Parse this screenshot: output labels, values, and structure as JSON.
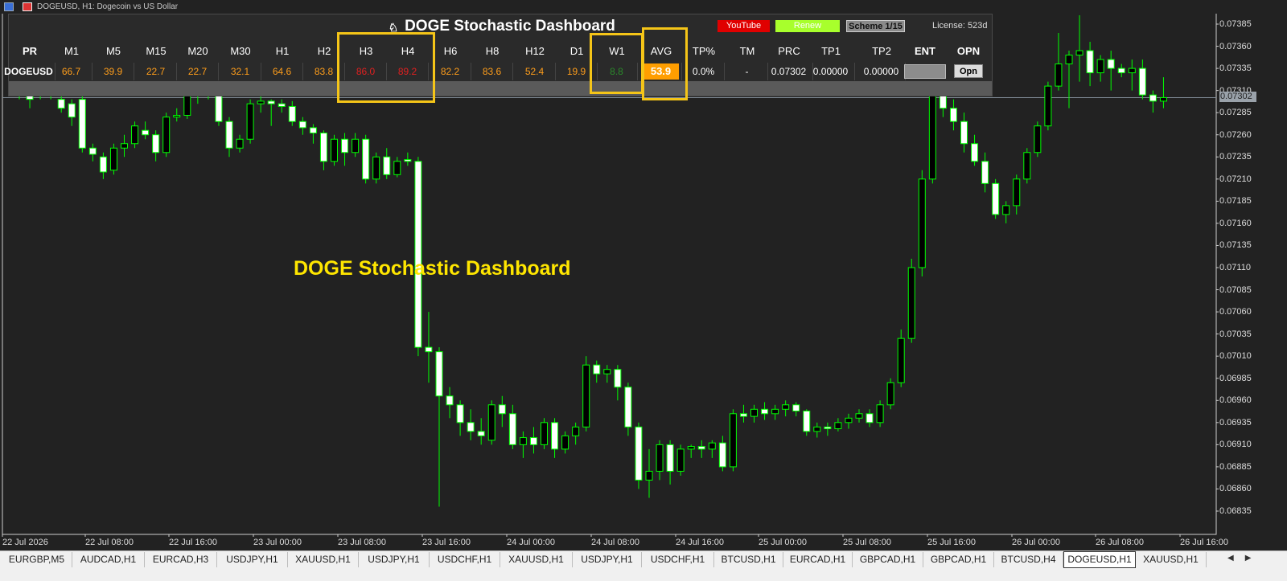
{
  "window": {
    "title": "DOGEUSD, H1:  Dogecoin vs US Dollar"
  },
  "dashboard": {
    "title": "DOGE Stochastic Dashboard",
    "youtube_label": "YouTube",
    "renew_label": "Renew",
    "scheme_label": "Scheme 1/15",
    "license": "License: 523d",
    "headers": [
      "PR",
      "M1",
      "M5",
      "M15",
      "M20",
      "M30",
      "H1",
      "H2",
      "H3",
      "H4",
      "H6",
      "H8",
      "H12",
      "D1",
      "W1",
      "AVG",
      "TP%",
      "TM",
      "PRC",
      "TP1",
      "TP2",
      "ENT",
      "OPN"
    ],
    "row": {
      "symbol": "DOGEUSD",
      "values": [
        "66.7",
        "39.9",
        "22.7",
        "22.7",
        "32.1",
        "64.6",
        "83.8",
        "86.0",
        "89.2",
        "82.2",
        "83.6",
        "52.4",
        "19.9",
        "8.8",
        "53.9"
      ],
      "tp_pct": "0.0%",
      "tm": "-",
      "prc": "0.07302",
      "tp1": "0.00000",
      "tp2": "0.00000",
      "opn_label": "Opn"
    }
  },
  "overlay_title": "DOGE Stochastic Dashboard",
  "price_axis": {
    "ticks": [
      "0.07385",
      "0.07360",
      "0.07335",
      "0.07310",
      "0.07285",
      "0.07260",
      "0.07235",
      "0.07210",
      "0.07185",
      "0.07160",
      "0.07135",
      "0.07110",
      "0.07085",
      "0.07060",
      "0.07035",
      "0.07010",
      "0.06985",
      "0.06960",
      "0.06935",
      "0.06910",
      "0.06885",
      "0.06860",
      "0.06835"
    ],
    "current": "0.07302"
  },
  "time_axis": {
    "ticks": [
      "22 Jul 2026",
      "22 Jul 08:00",
      "22 Jul 16:00",
      "23 Jul 00:00",
      "23 Jul 08:00",
      "23 Jul 16:00",
      "24 Jul 00:00",
      "24 Jul 08:00",
      "24 Jul 16:00",
      "25 Jul 00:00",
      "25 Jul 08:00",
      "25 Jul 16:00",
      "26 Jul 00:00",
      "26 Jul 08:00",
      "26 Jul 16:00"
    ]
  },
  "tabs": [
    "EURGBP,M5",
    "AUDCAD,H1",
    "EURCAD,H3",
    "USDJPY,H1",
    "XAUUSD,H1",
    "USDJPY,H1",
    "USDCHF,H1",
    "XAUUSD,H1",
    "USDJPY,H1",
    "USDCHF,H1",
    "BTCUSD,H1",
    "EURCAD,H1",
    "GBPCAD,H1",
    "GBPCAD,H1",
    "BTCUSD,H4",
    "DOGEUSD,H1",
    "XAUUSD,H1"
  ],
  "active_tab": "DOGEUSD,H1",
  "colors": {
    "background": "#222222",
    "bull_candle": "#000000",
    "bear_candle": "#ffffff",
    "wick": "#00ff00",
    "youtube": "#e00000",
    "renew": "#a8ff2c",
    "avg_badge": "#ff9e00",
    "highlight": "#f5c518",
    "overlay_text": "#ffe600"
  },
  "chart_data": {
    "type": "candlestick",
    "symbol": "DOGEUSD",
    "timeframe": "H1",
    "ylim": [
      0.0682,
      0.074
    ],
    "candles": [
      [
        0.07322,
        0.0733,
        0.073,
        0.07305
      ],
      [
        0.07305,
        0.0731,
        0.0729,
        0.073
      ],
      [
        0.0731,
        0.0732,
        0.073,
        0.07308
      ],
      [
        0.07312,
        0.0732,
        0.073,
        0.07305
      ],
      [
        0.073,
        0.0731,
        0.07285,
        0.0729
      ],
      [
        0.07295,
        0.073,
        0.0727,
        0.0728
      ],
      [
        0.073,
        0.07305,
        0.0724,
        0.07245
      ],
      [
        0.07245,
        0.0725,
        0.0723,
        0.07238
      ],
      [
        0.07235,
        0.0724,
        0.0721,
        0.07218
      ],
      [
        0.0722,
        0.0725,
        0.07215,
        0.07245
      ],
      [
        0.07245,
        0.0726,
        0.07235,
        0.0725
      ],
      [
        0.0725,
        0.07275,
        0.07245,
        0.0727
      ],
      [
        0.07265,
        0.07275,
        0.07255,
        0.0726
      ],
      [
        0.0726,
        0.07265,
        0.0723,
        0.0724
      ],
      [
        0.0724,
        0.07285,
        0.07235,
        0.0728
      ],
      [
        0.0728,
        0.0729,
        0.07275,
        0.07282
      ],
      [
        0.07282,
        0.07315,
        0.07278,
        0.07305
      ],
      [
        0.07305,
        0.0732,
        0.07295,
        0.07308
      ],
      [
        0.07308,
        0.07318,
        0.073,
        0.0731
      ],
      [
        0.0731,
        0.07312,
        0.0727,
        0.07275
      ],
      [
        0.07275,
        0.0728,
        0.07235,
        0.07245
      ],
      [
        0.07245,
        0.0726,
        0.0724,
        0.07255
      ],
      [
        0.07255,
        0.073,
        0.0725,
        0.07295
      ],
      [
        0.07295,
        0.07305,
        0.07285,
        0.07298
      ],
      [
        0.07298,
        0.073,
        0.0727,
        0.07295
      ],
      [
        0.07295,
        0.073,
        0.07285,
        0.07292
      ],
      [
        0.07292,
        0.07298,
        0.0727,
        0.07275
      ],
      [
        0.07275,
        0.0728,
        0.0726,
        0.07268
      ],
      [
        0.07268,
        0.07272,
        0.0725,
        0.07262
      ],
      [
        0.07262,
        0.07265,
        0.0722,
        0.0723
      ],
      [
        0.0723,
        0.0726,
        0.07225,
        0.07255
      ],
      [
        0.07255,
        0.07262,
        0.07225,
        0.0724
      ],
      [
        0.0724,
        0.07262,
        0.07235,
        0.07255
      ],
      [
        0.07255,
        0.0726,
        0.07205,
        0.0721
      ],
      [
        0.0721,
        0.0724,
        0.07205,
        0.07235
      ],
      [
        0.07235,
        0.07245,
        0.0721,
        0.07215
      ],
      [
        0.07215,
        0.07235,
        0.07212,
        0.0723
      ],
      [
        0.07232,
        0.0724,
        0.07225,
        0.0723
      ],
      [
        0.0723,
        0.07235,
        0.0701,
        0.0702
      ],
      [
        0.0702,
        0.0706,
        0.0698,
        0.07015
      ],
      [
        0.07015,
        0.0702,
        0.0684,
        0.06965
      ],
      [
        0.06965,
        0.06975,
        0.0694,
        0.06955
      ],
      [
        0.06955,
        0.0696,
        0.0692,
        0.06935
      ],
      [
        0.06935,
        0.0695,
        0.06915,
        0.06925
      ],
      [
        0.06925,
        0.0694,
        0.0691,
        0.0692
      ],
      [
        0.06915,
        0.0696,
        0.0691,
        0.06955
      ],
      [
        0.06955,
        0.06965,
        0.0693,
        0.06945
      ],
      [
        0.06945,
        0.06955,
        0.06905,
        0.0691
      ],
      [
        0.0691,
        0.06925,
        0.06895,
        0.06918
      ],
      [
        0.06918,
        0.0693,
        0.069,
        0.0691
      ],
      [
        0.0691,
        0.0694,
        0.06905,
        0.06935
      ],
      [
        0.06935,
        0.0694,
        0.06895,
        0.06905
      ],
      [
        0.06905,
        0.06925,
        0.069,
        0.0692
      ],
      [
        0.0692,
        0.06935,
        0.0691,
        0.0693
      ],
      [
        0.0693,
        0.0701,
        0.06925,
        0.07
      ],
      [
        0.07,
        0.07005,
        0.0698,
        0.0699
      ],
      [
        0.0699,
        0.07,
        0.0698,
        0.06995
      ],
      [
        0.06995,
        0.07,
        0.0696,
        0.06975
      ],
      [
        0.06975,
        0.0698,
        0.0692,
        0.0693
      ],
      [
        0.0693,
        0.06935,
        0.0686,
        0.0687
      ],
      [
        0.0687,
        0.06905,
        0.0685,
        0.0688
      ],
      [
        0.0688,
        0.06915,
        0.0687,
        0.0691
      ],
      [
        0.0691,
        0.06915,
        0.06865,
        0.0688
      ],
      [
        0.0688,
        0.0691,
        0.06875,
        0.06905
      ],
      [
        0.06905,
        0.0691,
        0.06895,
        0.06908
      ],
      [
        0.06908,
        0.06915,
        0.06895,
        0.06905
      ],
      [
        0.06905,
        0.06915,
        0.06895,
        0.06912
      ],
      [
        0.06912,
        0.0692,
        0.0688,
        0.06885
      ],
      [
        0.06885,
        0.0695,
        0.0688,
        0.06945
      ],
      [
        0.06945,
        0.06955,
        0.06935,
        0.06942
      ],
      [
        0.06942,
        0.06955,
        0.06935,
        0.0695
      ],
      [
        0.0695,
        0.06958,
        0.06938,
        0.06945
      ],
      [
        0.06945,
        0.06955,
        0.06938,
        0.0695
      ],
      [
        0.0695,
        0.0696,
        0.06942,
        0.06955
      ],
      [
        0.06955,
        0.06958,
        0.06942,
        0.06948
      ],
      [
        0.06948,
        0.0695,
        0.0692,
        0.06925
      ],
      [
        0.06925,
        0.06935,
        0.06918,
        0.0693
      ],
      [
        0.0693,
        0.06935,
        0.0692,
        0.06928
      ],
      [
        0.06928,
        0.0694,
        0.06925,
        0.06935
      ],
      [
        0.06935,
        0.06945,
        0.06928,
        0.0694
      ],
      [
        0.0694,
        0.0695,
        0.06935,
        0.06945
      ],
      [
        0.06945,
        0.0695,
        0.0693,
        0.06935
      ],
      [
        0.06935,
        0.0696,
        0.0693,
        0.06955
      ],
      [
        0.06955,
        0.06985,
        0.0695,
        0.0698
      ],
      [
        0.0698,
        0.0704,
        0.06975,
        0.0703
      ],
      [
        0.0703,
        0.0712,
        0.07025,
        0.0711
      ],
      [
        0.0711,
        0.0722,
        0.071,
        0.0721
      ],
      [
        0.0721,
        0.0732,
        0.07205,
        0.07305
      ],
      [
        0.07305,
        0.0732,
        0.0728,
        0.0729
      ],
      [
        0.0729,
        0.073,
        0.07265,
        0.07275
      ],
      [
        0.07275,
        0.07285,
        0.0724,
        0.0725
      ],
      [
        0.0725,
        0.0726,
        0.07225,
        0.0723
      ],
      [
        0.0723,
        0.0724,
        0.07195,
        0.07205
      ],
      [
        0.07205,
        0.0721,
        0.07165,
        0.0717
      ],
      [
        0.0717,
        0.07185,
        0.0716,
        0.0718
      ],
      [
        0.0718,
        0.07215,
        0.0717,
        0.0721
      ],
      [
        0.0721,
        0.07245,
        0.07205,
        0.0724
      ],
      [
        0.0724,
        0.07275,
        0.07235,
        0.0727
      ],
      [
        0.0727,
        0.0732,
        0.07265,
        0.07315
      ],
      [
        0.07315,
        0.07375,
        0.0731,
        0.0734
      ],
      [
        0.0734,
        0.07355,
        0.0729,
        0.0735
      ],
      [
        0.0735,
        0.07395,
        0.0732,
        0.07355
      ],
      [
        0.07355,
        0.07365,
        0.07315,
        0.0733
      ],
      [
        0.0733,
        0.0735,
        0.0732,
        0.07345
      ],
      [
        0.07345,
        0.07355,
        0.0731,
        0.07335
      ],
      [
        0.07335,
        0.0734,
        0.07325,
        0.0733
      ],
      [
        0.0733,
        0.07345,
        0.0731,
        0.07335
      ],
      [
        0.07335,
        0.07345,
        0.073,
        0.07305
      ],
      [
        0.07305,
        0.0731,
        0.07285,
        0.07298
      ],
      [
        0.07298,
        0.07325,
        0.0729,
        0.07302
      ]
    ]
  }
}
